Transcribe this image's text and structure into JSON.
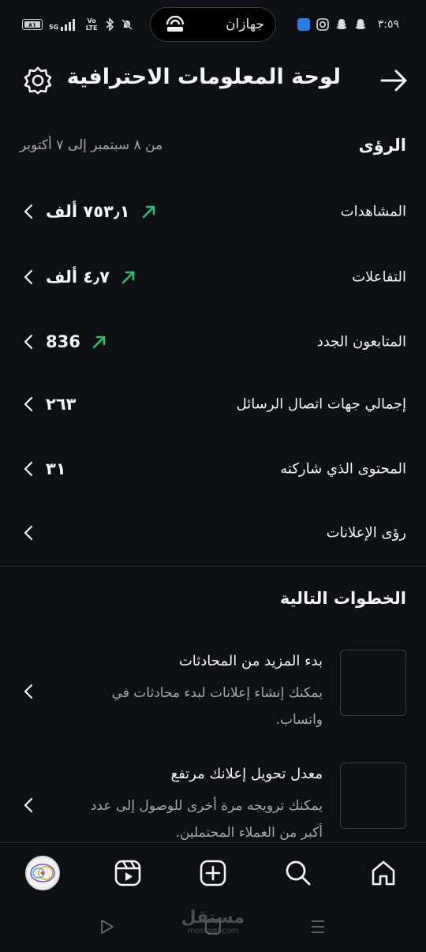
{
  "status_bar": {
    "time": "٣:٥٩",
    "carrier": "جهازان",
    "battery": "٨١",
    "network": "5G",
    "volte": "Vo LTE"
  },
  "header": {
    "title": "لوحة المعلومات الاحترافية"
  },
  "insights": {
    "title": "الرؤى",
    "date_range": "من ٨ سبتمبر إلى ٧ أكتوبر",
    "rows": [
      {
        "label": "المشاهدات",
        "value": "٧٥٣٫١ ألف",
        "trend": "up"
      },
      {
        "label": "التفاعلات",
        "value": "٤٫٧ ألف",
        "trend": "up"
      },
      {
        "label": "المتابعون الجدد",
        "value": "836",
        "trend": "up"
      },
      {
        "label": "إجمالي جهات اتصال الرسائل",
        "value": "٢٦٣",
        "trend": ""
      },
      {
        "label": "المحتوى الذي شاركته",
        "value": "٣١",
        "trend": ""
      },
      {
        "label": "رؤى الإعلانات",
        "value": "",
        "trend": ""
      }
    ]
  },
  "next_steps": {
    "title": "الخطوات التالية",
    "items": [
      {
        "title": "بدء المزيد من المحادثات",
        "description": "يمكنك إنشاء إعلانات لبدء محادثات في واتساب."
      },
      {
        "title": "معدل تحويل إعلانك مرتفع",
        "description": "يمكنك ترويجه مرة أخرى للوصول إلى عدد أكبر من العملاء المحتملين."
      }
    ]
  },
  "watermark": {
    "arabic": "مستقل",
    "latin": "mostaql.com"
  },
  "colors": {
    "background": "#0c1014",
    "trend_up": "#2fbf71",
    "muted_text": "#a8a8a8",
    "divider": "#262a2e"
  },
  "icons": {
    "back": "arrow-right-icon",
    "settings": "gear-icon",
    "row_chevron": "chevron-left-icon",
    "trend": "arrow-up-right-icon",
    "nav": [
      "home-icon",
      "search-icon",
      "plus-square-icon",
      "reels-icon",
      "profile-avatar"
    ],
    "system_nav": [
      "menu-lines-icon",
      "home-square-icon",
      "back-triangle-icon"
    ]
  }
}
